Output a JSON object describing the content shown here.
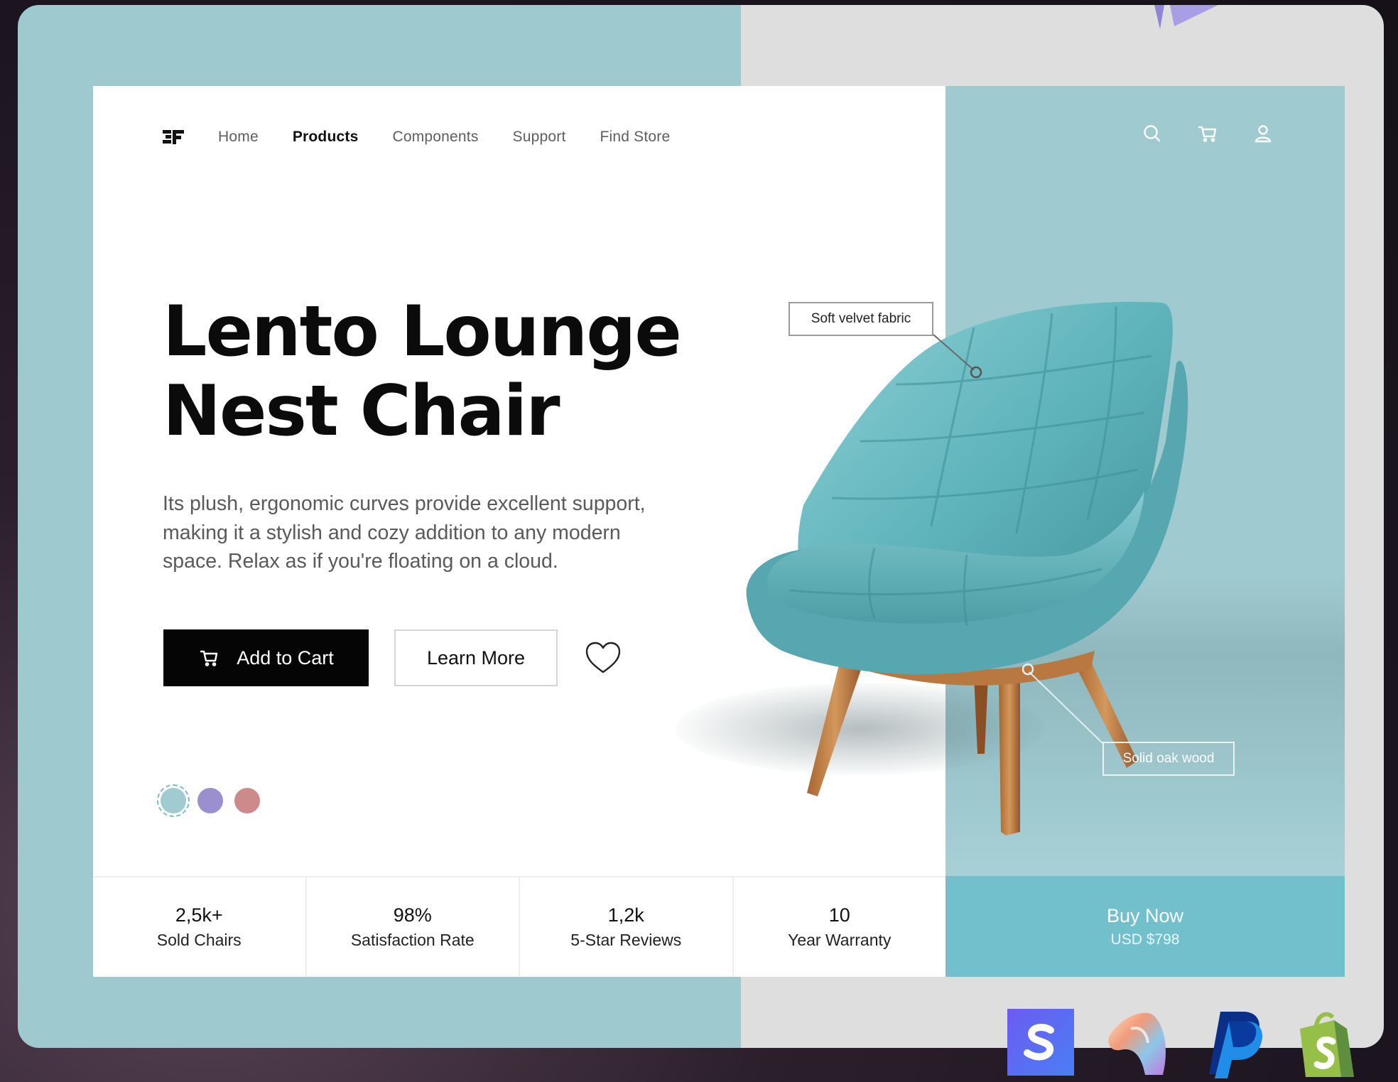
{
  "nav": {
    "logo_icon": "brand-logo-icon",
    "items": [
      {
        "label": "Home",
        "active": false
      },
      {
        "label": "Products",
        "active": true
      },
      {
        "label": "Components",
        "active": false
      },
      {
        "label": "Support",
        "active": false
      },
      {
        "label": "Find Store",
        "active": false
      }
    ],
    "icons": [
      "search-icon",
      "cart-icon",
      "user-icon"
    ]
  },
  "hero": {
    "title_line1": "Lento Lounge",
    "title_line2": "Nest Chair",
    "description_line1": "Its plush, ergonomic curves provide excellent support,",
    "description_line2": "making it a stylish and cozy addition to any modern",
    "description_line3": "space. Relax as if you're floating on a cloud.",
    "add_to_cart_label": "Add to Cart",
    "learn_more_label": "Learn More",
    "wishlist_icon": "heart-icon"
  },
  "colors": {
    "swatches": [
      "#9fcbd1",
      "#9b8fcf",
      "#cd8a8a"
    ],
    "selected_index": 0,
    "accent": "#72c0cc",
    "panel": "#9fcad0"
  },
  "callouts": {
    "fabric": "Soft velvet fabric",
    "wood": "Solid oak wood"
  },
  "stats": [
    {
      "value": "2,5k+",
      "label": "Sold Chairs"
    },
    {
      "value": "98%",
      "label": "Satisfaction Rate"
    },
    {
      "value": "1,2k",
      "label": "5-Star Reviews"
    },
    {
      "value": "10",
      "label": "Year Warranty"
    }
  ],
  "buy": {
    "title": "Buy Now",
    "price": "USD $798"
  },
  "brand_badges": [
    "stripe-icon",
    "iridescent-shape-icon",
    "paypal-icon",
    "shopify-icon"
  ]
}
